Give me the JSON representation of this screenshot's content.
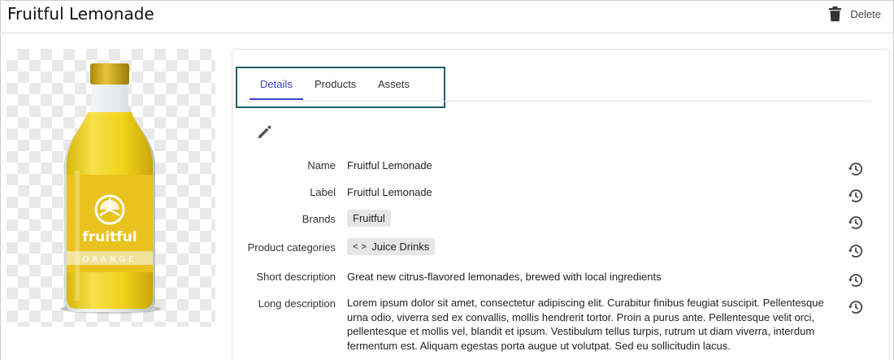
{
  "header": {
    "title": "Fruitful Lemonade",
    "delete_label": "Delete"
  },
  "product_image": {
    "brand_text": "fruitful",
    "flavor_text": "ORANGE",
    "colors": {
      "liquid": "#f2d21a",
      "cap": "#d4ac16",
      "label": "#e9c21e",
      "checker": "#e9e9e9"
    }
  },
  "tabs": [
    {
      "label": "Details",
      "active": true
    },
    {
      "label": "Products",
      "active": false
    },
    {
      "label": "Assets",
      "active": false
    }
  ],
  "icons": {
    "delete": "trash-icon",
    "edit": "pencil-icon",
    "history": "history-icon",
    "category": "code-brackets-icon"
  },
  "fields": {
    "name": {
      "label": "Name",
      "value": "Fruitful Lemonade"
    },
    "label": {
      "label": "Label",
      "value": "Fruitful Lemonade"
    },
    "brands": {
      "label": "Brands",
      "value": "Fruitful"
    },
    "categories": {
      "label": "Product categories",
      "value": "Juice Drinks"
    },
    "short_description": {
      "label": "Short description",
      "value": "Great new citrus-flavored lemonades, brewed with local ingredients"
    },
    "long_description": {
      "label": "Long description",
      "value": "Lorem ipsum dolor sit amet, consectetur adipiscing elit. Curabitur finibus feugiat suscipit. Pellentesque urna odio, viverra sed ex convallis, mollis hendrerit tortor. Proin a purus ante. Pellentesque velit orci, pellentesque et mollis vel, blandit et ipsum. Vestibulum tellus turpis, rutrum ut diam viverra, interdum fermentum est. Aliquam egestas porta augue ut volutpat. Sed eu sollicitudin lacus."
    }
  },
  "theme": {
    "accent": "#3b3fd8",
    "highlight_box": "#1f5f66"
  }
}
